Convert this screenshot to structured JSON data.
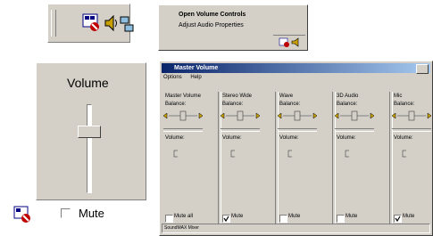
{
  "context_menu": {
    "items": [
      "Open Volume Controls",
      "Adjust Audio Properties"
    ]
  },
  "volume_popup": {
    "title": "Volume",
    "mute_label": "Mute",
    "volume_level": 0.7
  },
  "mixer": {
    "title": "Master Volume",
    "menu": [
      "Options",
      "Help"
    ],
    "balance_label": "Balance:",
    "volume_label": "Volume:",
    "channels": [
      {
        "name": "Master Volume",
        "check": "Mute all",
        "checked": false
      },
      {
        "name": "Stereo Wide",
        "check": "Mute",
        "checked": true
      },
      {
        "name": "Wave",
        "check": "Mute",
        "checked": false
      },
      {
        "name": "3D Audio",
        "check": "Mute",
        "checked": false
      },
      {
        "name": "Mic",
        "check": "Mute",
        "checked": true
      }
    ],
    "status": "SoundMAX Mixer"
  }
}
